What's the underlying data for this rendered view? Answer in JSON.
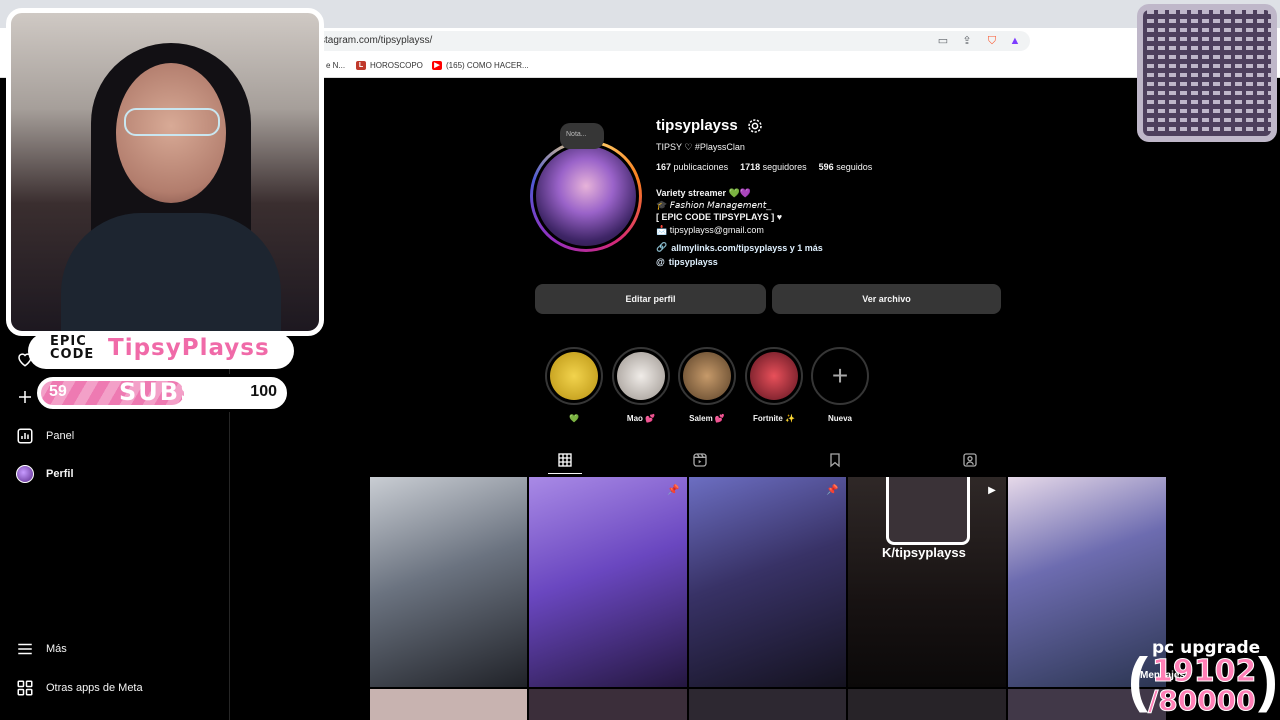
{
  "browser": {
    "url": "stagram.com/tipsyplayss/",
    "bookmarks": [
      {
        "label": "e N...",
        "color": "#1877f2",
        "glyph": ""
      },
      {
        "label": "HOROSCOPO",
        "color": "#c0392b",
        "glyph": "L"
      },
      {
        "label": "(165) COMO HACER...",
        "color": "#ff0000",
        "glyph": "▶"
      }
    ]
  },
  "sidebar": {
    "items": [
      {
        "label": "Panel",
        "icon": "bar-chart-icon"
      },
      {
        "label": "Perfil",
        "icon": "avatar"
      },
      {
        "label": "Más",
        "icon": "hamburger-icon"
      },
      {
        "label": "Otras apps de Meta",
        "icon": "meta-apps-icon"
      }
    ]
  },
  "profile": {
    "note": "Nota...",
    "username": "tipsyplayss",
    "fullname": "TIPSY ♡ #PlayssClan",
    "stats": {
      "posts_count": "167",
      "posts_label": "publicaciones",
      "followers_count": "1718",
      "followers_label": "seguidores",
      "following_count": "596",
      "following_label": "seguidos"
    },
    "bio": [
      "Variety streamer 💚💜",
      "🎓 𝘍𝘢𝘴𝘩𝘪𝘰𝘯 𝘔𝘢𝘯𝘢𝘨𝘦𝘮𝘦𝘯𝘵_",
      "[ EPIC CODE TIPSYPLAYS ] ♥",
      "📩 tipsyplayss@gmail.com"
    ],
    "link": "allmylinks.com/tipsyplayss y 1 más",
    "threads": "tipsyplayss",
    "edit_button": "Editar perfil",
    "archive_button": "Ver archivo"
  },
  "highlights": [
    {
      "label": "💚",
      "color": "#e8c23b"
    },
    {
      "label": "Mao 💕",
      "color": "#d9d4d0"
    },
    {
      "label": "Salem 💕",
      "color": "#8a6a47"
    },
    {
      "label": "Fortnite ✨",
      "color": "#b2323b"
    },
    {
      "label": "Nueva",
      "color": "#000000"
    }
  ],
  "tabs": [
    "posts-grid-icon",
    "reels-icon",
    "saved-icon",
    "tagged-icon"
  ],
  "grid": [
    {
      "badge": "",
      "colors": [
        "#9aa0a8",
        "#4a5060",
        "#1c1d22"
      ]
    },
    {
      "badge": "📌",
      "colors": [
        "#8b6fd6",
        "#5b3fa8",
        "#2a1d4a"
      ]
    },
    {
      "badge": "📌",
      "colors": [
        "#5d5fa6",
        "#2f2a55",
        "#141225"
      ]
    },
    {
      "badge": "▶",
      "colors": [
        "#2a2322",
        "#1a1414",
        "#0c0a0a"
      ]
    },
    {
      "badge": "",
      "colors": [
        "#d9c8df",
        "#5d5fa8",
        "#2f3b5a"
      ]
    }
  ],
  "grid_caption": "K/tipsyplayss",
  "overlay": {
    "epic": "EPIC",
    "code": "CODE",
    "channel": "TipsyPlayss",
    "sub_current": "59",
    "sub_label": "SUBS",
    "sub_goal": "100",
    "sub_fraction": 0.59,
    "upgrade_title": "pc upgrade",
    "upgrade_current": "19102",
    "upgrade_goal": "/80000",
    "messages": "Mensajes"
  }
}
